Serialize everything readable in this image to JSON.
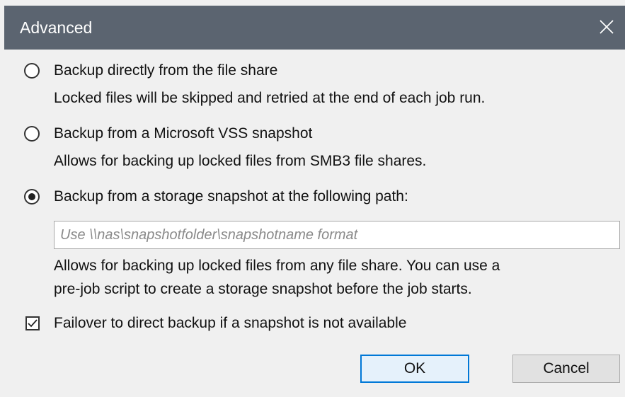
{
  "window": {
    "title": "Advanced"
  },
  "options": [
    {
      "label": "Backup directly from the file share",
      "description": [
        "Locked files will be skipped and retried at the end of each job run."
      ],
      "selected": false
    },
    {
      "label": "Backup from a Microsoft VSS snapshot",
      "description": [
        "Allows for backing up locked files from SMB3 file shares."
      ],
      "selected": false
    },
    {
      "label": "Backup from a storage snapshot at the following path:",
      "description": [
        "Allows for backing up locked files from any file share. You can use a",
        "pre-job script to create a storage snapshot before the job starts."
      ],
      "selected": true
    }
  ],
  "snapshot_path": {
    "value": "",
    "placeholder": "Use \\\\nas\\snapshotfolder\\snapshotname format"
  },
  "failover": {
    "label": "Failover to direct backup if a snapshot is not available",
    "checked": true
  },
  "buttons": {
    "ok": "OK",
    "cancel": "Cancel"
  },
  "colors": {
    "titlebar": "#5b6470",
    "background": "#f0f0f0",
    "accent": "#0078d7"
  }
}
